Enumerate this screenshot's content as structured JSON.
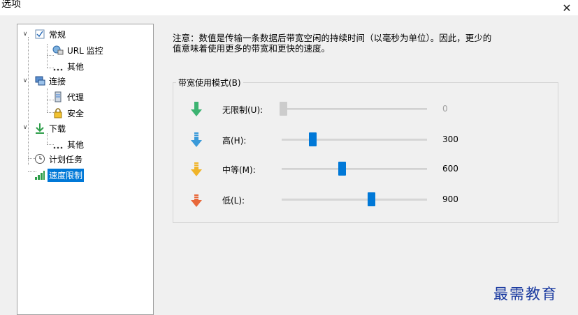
{
  "window": {
    "title": "选项",
    "close_glyph": "✕"
  },
  "tree": {
    "items": [
      {
        "label": "常规",
        "icon": "settings-icon",
        "expanded": true
      },
      {
        "label": "URL 监控",
        "icon": "url-monitor-icon"
      },
      {
        "label": "其他",
        "icon": "dots-icon"
      },
      {
        "label": "连接",
        "icon": "network-icon",
        "expanded": true
      },
      {
        "label": "代理",
        "icon": "proxy-icon"
      },
      {
        "label": "安全",
        "icon": "lock-icon"
      },
      {
        "label": "下载",
        "icon": "download-icon",
        "expanded": true
      },
      {
        "label": "其他",
        "icon": "dots-icon"
      },
      {
        "label": "计划任务",
        "icon": "clock-icon"
      },
      {
        "label": "速度限制",
        "icon": "bar-chart-icon",
        "selected": true
      }
    ]
  },
  "notice": {
    "line1": "注意：数值是传输一条数据后带宽空闲的持续时间（以毫秒为单位）。因此，更少的",
    "line2": "值意味着使用更多的带宽和更快的速度。"
  },
  "bandwidth": {
    "group_title": "带宽使用模式(B)",
    "rows": [
      {
        "label": "无限制(U):",
        "value": "0",
        "level": 0.0,
        "enabled": false,
        "color": "#3cb371"
      },
      {
        "label": "高(H):",
        "value": "300",
        "level": 0.2,
        "enabled": true,
        "color": "#3a9ad9"
      },
      {
        "label": "中等(M):",
        "value": "600",
        "level": 0.4,
        "enabled": true,
        "color": "#f0b429"
      },
      {
        "label": "低(L):",
        "value": "900",
        "level": 0.6,
        "enabled": true,
        "color": "#e8683a"
      }
    ]
  },
  "watermark": "最需教育"
}
